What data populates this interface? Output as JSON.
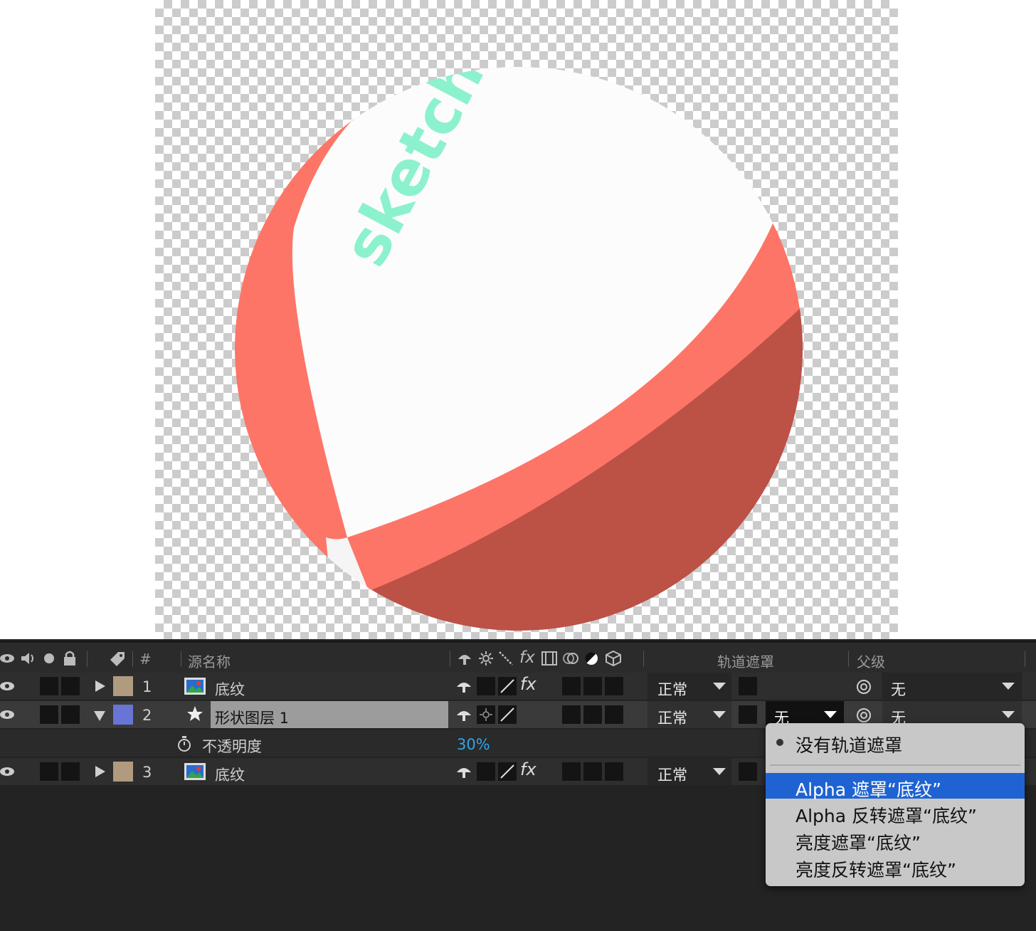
{
  "preview": {
    "ball_text": "sketchbox",
    "colors": {
      "stripe": "#fd7567",
      "stripe_dark": "#bc5146",
      "white": "#fcfcfc",
      "text": "#8cf1cd"
    }
  },
  "timeline": {
    "header": {
      "col_number": "#",
      "col_source_name": "源名称",
      "col_track_matte": "轨道遮罩",
      "col_parent": "父级",
      "switch_fx": "fx"
    },
    "layers": [
      {
        "number": "1",
        "name": "底纹",
        "type": "footage",
        "color": "#b09b7e",
        "expanded": false,
        "mode": "正常",
        "has_fx": true,
        "parent": "无"
      },
      {
        "number": "2",
        "name": "形状图层 1",
        "type": "shape",
        "color": "#6874d6",
        "expanded": true,
        "mode": "正常",
        "has_fx": false,
        "track_matte": "无",
        "parent": "无",
        "property": {
          "name": "不透明度",
          "value": "30%"
        }
      },
      {
        "number": "3",
        "name": "底纹",
        "type": "footage",
        "color": "#b09b7e",
        "expanded": false,
        "mode": "正常",
        "has_fx": true
      }
    ],
    "fx_label": "fx"
  },
  "track_matte_menu": {
    "items": [
      {
        "label": "没有轨道遮罩",
        "checked": true,
        "selected": false
      },
      {
        "label": "Alpha 遮罩“底纹”",
        "checked": false,
        "selected": true
      },
      {
        "label": "Alpha 反转遮罩“底纹”",
        "checked": false,
        "selected": false
      },
      {
        "label": "亮度遮罩“底纹”",
        "checked": false,
        "selected": false
      },
      {
        "label": "亮度反转遮罩“底纹”",
        "checked": false,
        "selected": false
      }
    ],
    "highlight_color": "#1f63d2"
  }
}
